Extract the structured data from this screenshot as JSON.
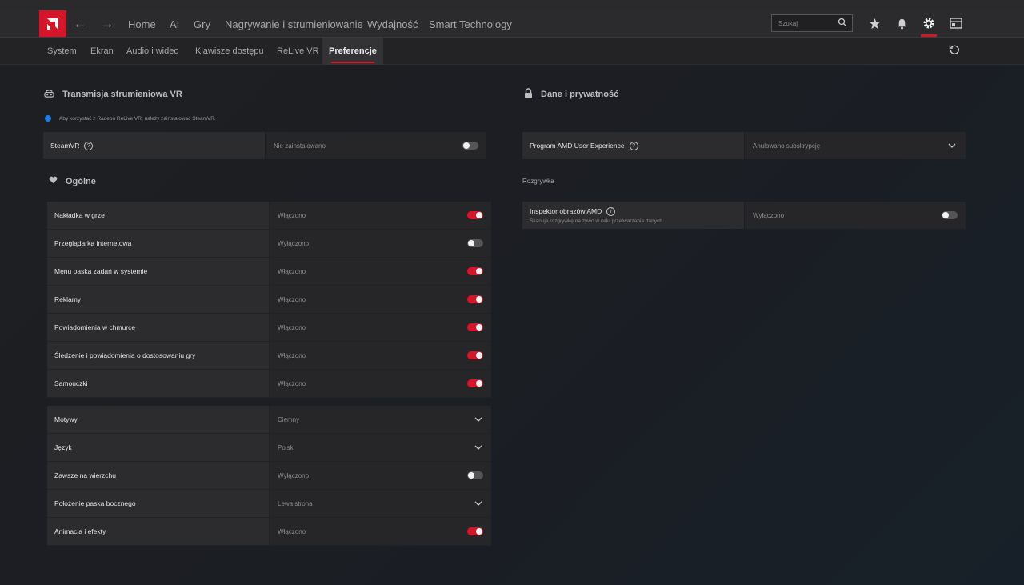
{
  "topbar": {
    "nav": [
      "Home",
      "AI",
      "Gry",
      "Nagrywanie i strumieniowanie",
      "Wydajność",
      "Smart Technology"
    ],
    "search_placeholder": "Szukaj"
  },
  "subtabs": [
    "System",
    "Ekran",
    "Audio i wideo",
    "Klawisze dostępu",
    "ReLive VR",
    "Preferencje"
  ],
  "vr": {
    "title": "Transmisja strumieniowa VR",
    "info": "Aby korzystać z Radeon ReLive VR, należy zainstalować SteamVR.",
    "steamvr": {
      "label": "SteamVR",
      "value": "Nie zainstalowano",
      "on": false
    }
  },
  "general": {
    "title": "Ogólne",
    "rows": [
      {
        "label": "Nakładka w grze",
        "value": "Włączono",
        "on": true
      },
      {
        "label": "Przeglądarka internetowa",
        "value": "Wyłączono",
        "on": false
      },
      {
        "label": "Menu paska zadań w systemie",
        "value": "Włączono",
        "on": true
      },
      {
        "label": "Reklamy",
        "value": "Włączono",
        "on": true
      },
      {
        "label": "Powiadomienia w chmurce",
        "value": "Włączono",
        "on": true
      },
      {
        "label": "Śledzenie i powiadomienia o dostosowaniu gry",
        "value": "Włączono",
        "on": true
      },
      {
        "label": "Samouczki",
        "value": "Włączono",
        "on": true
      }
    ],
    "rows2": [
      {
        "label": "Motywy",
        "value": "Ciemny",
        "control": "dropdown"
      },
      {
        "label": "Język",
        "value": "Polski",
        "control": "dropdown"
      },
      {
        "label": "Zawsze na wierzchu",
        "value": "Wyłączono",
        "control": "toggle",
        "on": false
      },
      {
        "label": "Położenie paska bocznego",
        "value": "Lewa strona",
        "control": "dropdown"
      },
      {
        "label": "Animacja i efekty",
        "value": "Włączono",
        "control": "toggle",
        "on": true
      }
    ]
  },
  "privacy": {
    "title": "Dane i prywatność",
    "program": {
      "label": "Program AMD User Experience",
      "value": "Anulowano subskrypcję"
    }
  },
  "gameplay": {
    "title": "Rozgrywka",
    "inspector": {
      "label": "Inspektor obrazów AMD",
      "desc": "Skanuje rozgrywkę na żywo w celu przetwarzania danych",
      "value": "Wyłączono",
      "on": false
    }
  },
  "colors": {
    "accent": "#d5162a",
    "info": "#1e7ee6"
  }
}
